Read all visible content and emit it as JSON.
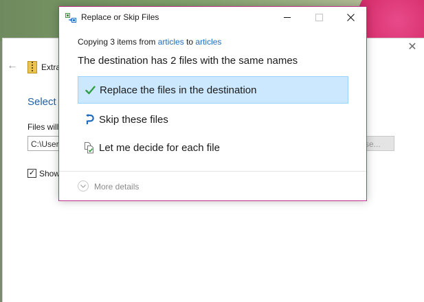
{
  "background_window": {
    "title": "Extra",
    "heading": "Select",
    "files_label": "Files will",
    "path_value": "C:\\User",
    "browse_label": "se...",
    "show_label": "Show",
    "show_checked": true
  },
  "dialog": {
    "title": "Replace or Skip Files",
    "copying_prefix": "Copying 3 items from ",
    "source": "articles",
    "copying_mid": " to ",
    "destination": "articles",
    "message": "The destination has 2 files with the same names",
    "options": [
      {
        "label": "Replace the files in the destination",
        "icon": "check-icon",
        "selected": true
      },
      {
        "label": "Skip these files",
        "icon": "skip-arrow-icon",
        "selected": false
      },
      {
        "label": "Let me decide for each file",
        "icon": "compare-files-icon",
        "selected": false
      }
    ],
    "more_details": "More details"
  },
  "colors": {
    "accent_border": "#c2328a",
    "selected_bg": "#cce8ff",
    "link": "#1b6cc0",
    "check_green": "#2f9e44"
  }
}
